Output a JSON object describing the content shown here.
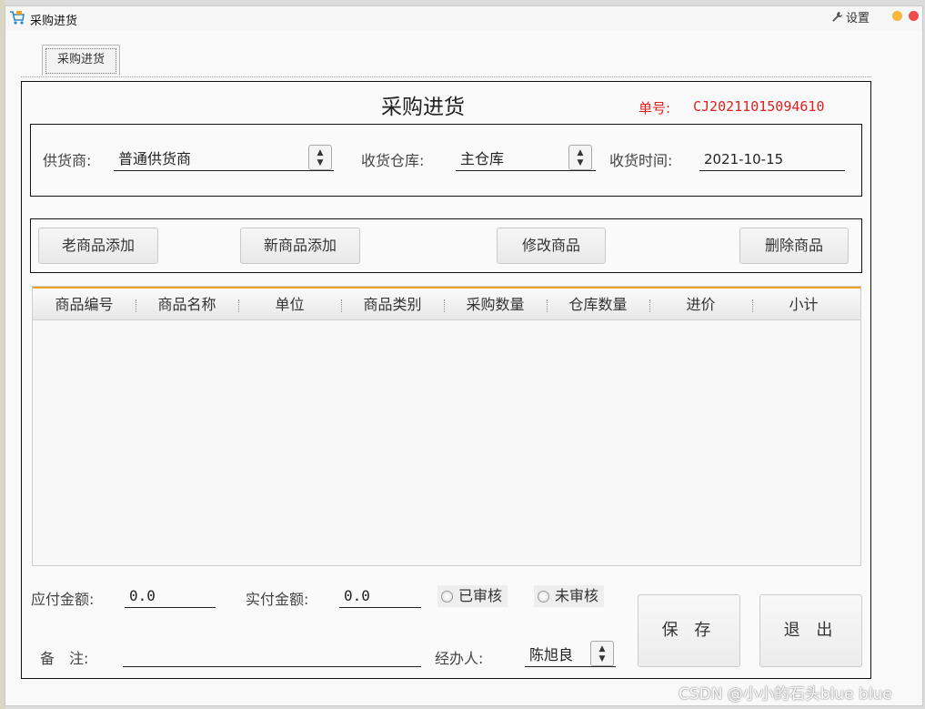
{
  "window": {
    "title": "采购进货",
    "settings_label": "设置"
  },
  "tab": {
    "label": "采购进货"
  },
  "form": {
    "heading": "采购进货",
    "order_label": "单号:",
    "order_no": "CJ20211015094610",
    "supplier_label": "供货商:",
    "supplier_value": "普通供货商",
    "warehouse_label": "收货仓库:",
    "warehouse_value": "主仓库",
    "date_label": "收货时间:",
    "date_value": "2021-10-15"
  },
  "actions": {
    "add_old": "老商品添加",
    "add_new": "新商品添加",
    "edit": "修改商品",
    "delete": "删除商品"
  },
  "table": {
    "columns": [
      "商品编号",
      "商品名称",
      "单位",
      "商品类别",
      "采购数量",
      "仓库数量",
      "进价",
      "小计"
    ],
    "rows": []
  },
  "footer": {
    "payable_label": "应付金额:",
    "payable_value": "0.0",
    "paid_label": "实付金额:",
    "paid_value": "0.0",
    "approved_label": "已审核",
    "unapproved_label": "未审核",
    "remark_label": "备　注:",
    "remark_value": "",
    "handler_label": "经办人:",
    "handler_value": "陈旭良",
    "save_label": "保 存",
    "exit_label": "退 出"
  },
  "watermark": "CSDN @小小的石头blue blue",
  "colors": {
    "accent_orange": "#f0a020",
    "order_red": "#e02020",
    "close_red": "#f04b4b",
    "minimize_yellow": "#f6b73c"
  }
}
